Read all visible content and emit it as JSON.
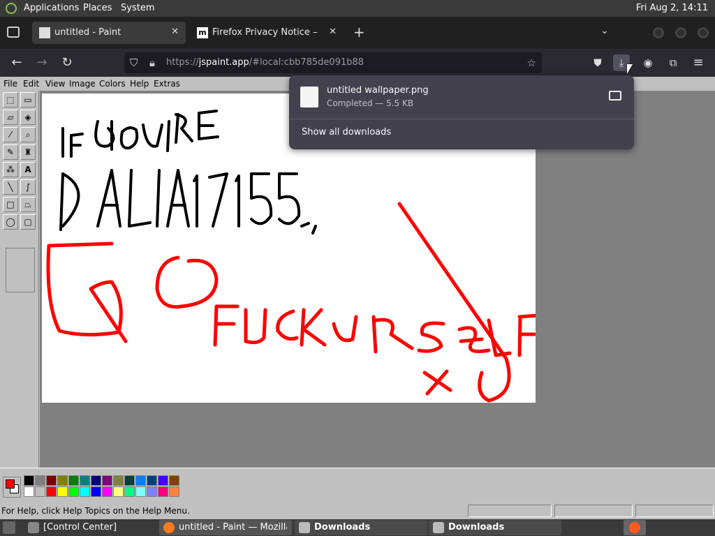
{
  "top_panel": {
    "menus": [
      "Applications",
      "Places",
      "System"
    ],
    "clock": "Fri Aug  2, 14:11"
  },
  "browser": {
    "tabs": [
      {
        "title": "untitled - Paint",
        "active": true
      },
      {
        "title": "Firefox Privacy Notice — Mo",
        "active": false
      }
    ],
    "url_prefix": "https://",
    "url_host": "jspaint.app",
    "url_rest": "/#local:cbb785de091b88",
    "download_panel": {
      "file_name": "untitled wallpaper.png",
      "status": "Completed — 5.5 KB",
      "show_all": "Show all downloads"
    }
  },
  "paint": {
    "menu": [
      "File",
      "Edit",
      "View",
      "Image",
      "Colors",
      "Help",
      "Extras"
    ],
    "status_text": "For Help, click Help Topics on the Help Menu.",
    "foreground_color": "#ff0000",
    "background_color": "#ffffff",
    "palette_top": [
      "#000000",
      "#808080",
      "#800000",
      "#808000",
      "#008000",
      "#008080",
      "#000080",
      "#800080",
      "#808040",
      "#004040",
      "#0080ff",
      "#004080",
      "#4000ff",
      "#804000"
    ],
    "palette_bottom": [
      "#ffffff",
      "#c0c0c0",
      "#ff0000",
      "#ffff00",
      "#00ff00",
      "#00ffff",
      "#0000ff",
      "#ff00ff",
      "#ffff80",
      "#00ff80",
      "#80ffff",
      "#8080ff",
      "#ff0080",
      "#ff8040"
    ],
    "drawing_text": {
      "line1": "IF GOU'RE",
      "line2": "DALIA17155,",
      "line3": "GO FUCKURSELF",
      "line4": "x)"
    }
  },
  "taskbar": {
    "items": [
      "[Control Center]",
      "untitled - Paint — Mozilla ...",
      "Downloads",
      "Downloads"
    ]
  }
}
